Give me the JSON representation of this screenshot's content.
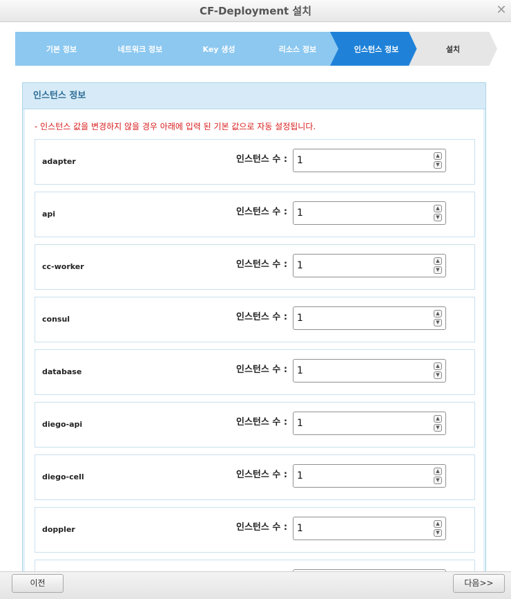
{
  "window": {
    "title": "CF-Deployment 설치",
    "close_glyph": "✕"
  },
  "steps": [
    {
      "label": "기본 정보",
      "state": "done"
    },
    {
      "label": "네트워크 정보",
      "state": "done"
    },
    {
      "label": "Key 생성",
      "state": "done"
    },
    {
      "label": "리소스 정보",
      "state": "done"
    },
    {
      "label": "인스턴스 정보",
      "state": "active"
    },
    {
      "label": "설치",
      "state": "todo"
    }
  ],
  "panel": {
    "title": "인스턴스 정보",
    "notice": "- 인스턴스 값을 변경하지 않을 경우 아래에 입력 된 기본 값으로 자동 설정됩니다.",
    "count_label": "인스턴스 수 :",
    "rows": [
      {
        "name": "adapter",
        "value": "1"
      },
      {
        "name": "api",
        "value": "1"
      },
      {
        "name": "cc-worker",
        "value": "1"
      },
      {
        "name": "consul",
        "value": "1"
      },
      {
        "name": "database",
        "value": "1"
      },
      {
        "name": "diego-api",
        "value": "1"
      },
      {
        "name": "diego-cell",
        "value": "1"
      },
      {
        "name": "doppler",
        "value": "1"
      },
      {
        "name": "",
        "value": ""
      }
    ]
  },
  "footer": {
    "prev_label": "이전",
    "next_label": "다음>>"
  },
  "colors": {
    "step_done": "#8cc8f0",
    "step_active": "#1f82d8",
    "step_todo": "#e6e6e6",
    "notice": "#d81b1b",
    "panel_header_bg": "#d6ebf7",
    "panel_header_text": "#2e6c95"
  }
}
